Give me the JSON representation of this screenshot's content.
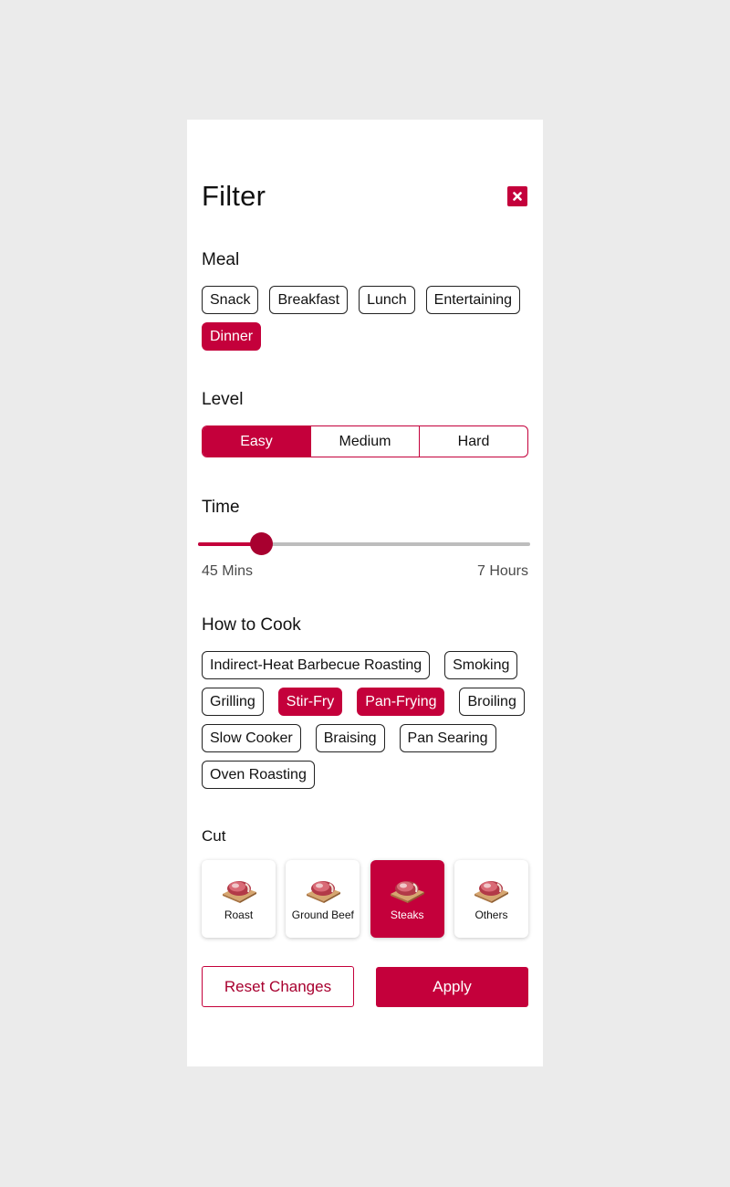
{
  "header": {
    "title": "Filter"
  },
  "meal": {
    "title": "Meal",
    "options": [
      {
        "label": "Snack",
        "selected": false
      },
      {
        "label": "Breakfast",
        "selected": false
      },
      {
        "label": "Lunch",
        "selected": false
      },
      {
        "label": "Entertaining",
        "selected": false
      },
      {
        "label": "Dinner",
        "selected": true
      }
    ]
  },
  "level": {
    "title": "Level",
    "options": [
      {
        "label": "Easy",
        "selected": true
      },
      {
        "label": "Medium",
        "selected": false
      },
      {
        "label": "Hard",
        "selected": false
      }
    ]
  },
  "time": {
    "title": "Time",
    "min_label": "45 Mins",
    "max_label": "7 Hours",
    "value_fraction": 0.19
  },
  "how_to_cook": {
    "title": "How to Cook",
    "options": [
      {
        "label": "Indirect-Heat Barbecue Roasting",
        "selected": false
      },
      {
        "label": "Smoking",
        "selected": false
      },
      {
        "label": "Grilling",
        "selected": false
      },
      {
        "label": "Stir-Fry",
        "selected": true
      },
      {
        "label": "Pan-Frying",
        "selected": true
      },
      {
        "label": "Broiling",
        "selected": false
      },
      {
        "label": "Slow Cooker",
        "selected": false
      },
      {
        "label": "Braising",
        "selected": false
      },
      {
        "label": "Pan Searing",
        "selected": false
      },
      {
        "label": "Oven Roasting",
        "selected": false
      }
    ]
  },
  "cut": {
    "title": "Cut",
    "options": [
      {
        "label": "Roast",
        "icon": "meat-icon",
        "selected": false
      },
      {
        "label": "Ground Beef",
        "icon": "meat-icon",
        "selected": false
      },
      {
        "label": "Steaks",
        "icon": "meat-icon",
        "selected": true
      },
      {
        "label": "Others",
        "icon": "meat-icon",
        "selected": false
      }
    ]
  },
  "actions": {
    "reset_label": "Reset Changes",
    "apply_label": "Apply"
  },
  "colors": {
    "accent": "#c4003b",
    "accent_dark": "#a8002f",
    "background": "#ebebeb",
    "panel": "#ffffff"
  }
}
